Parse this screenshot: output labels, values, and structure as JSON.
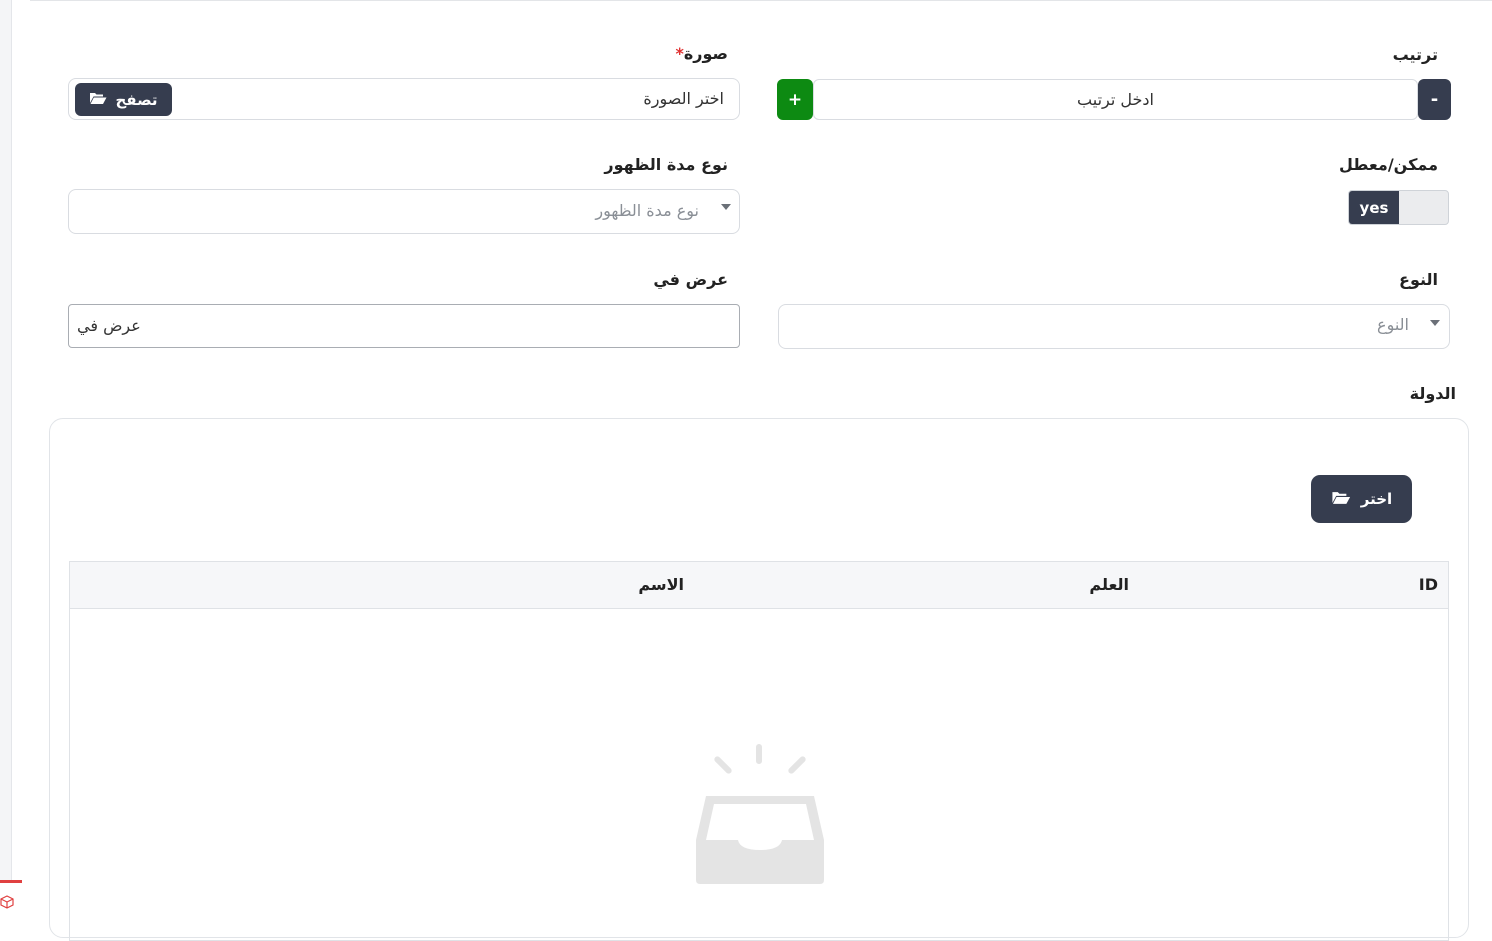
{
  "form": {
    "order": {
      "label": "ترتيب",
      "placeholder": "ادخل ترتيب",
      "decrement_label": "-",
      "increment_label": "+"
    },
    "image": {
      "label": "صورة",
      "required_mark": "*",
      "placeholder": "اختر الصورة",
      "browse_label": "تصفح"
    },
    "enabled": {
      "label": "ممكن/معطل",
      "toggle_text": "yes"
    },
    "display_duration_type": {
      "label": "نوع مدة الظهور",
      "placeholder": "نوع مدة الظهور"
    },
    "type": {
      "label": "النوع",
      "placeholder": "النوع"
    },
    "display_in": {
      "label": "عرض في",
      "value": "عرض في"
    },
    "country": {
      "label": "الدولة",
      "choose_label": "اختر",
      "columns": [
        "ID",
        "العلم",
        "الاسم"
      ]
    }
  },
  "colors": {
    "dark_button": "#363d4f",
    "green_button": "#0d8a12",
    "required": "#e03030"
  }
}
